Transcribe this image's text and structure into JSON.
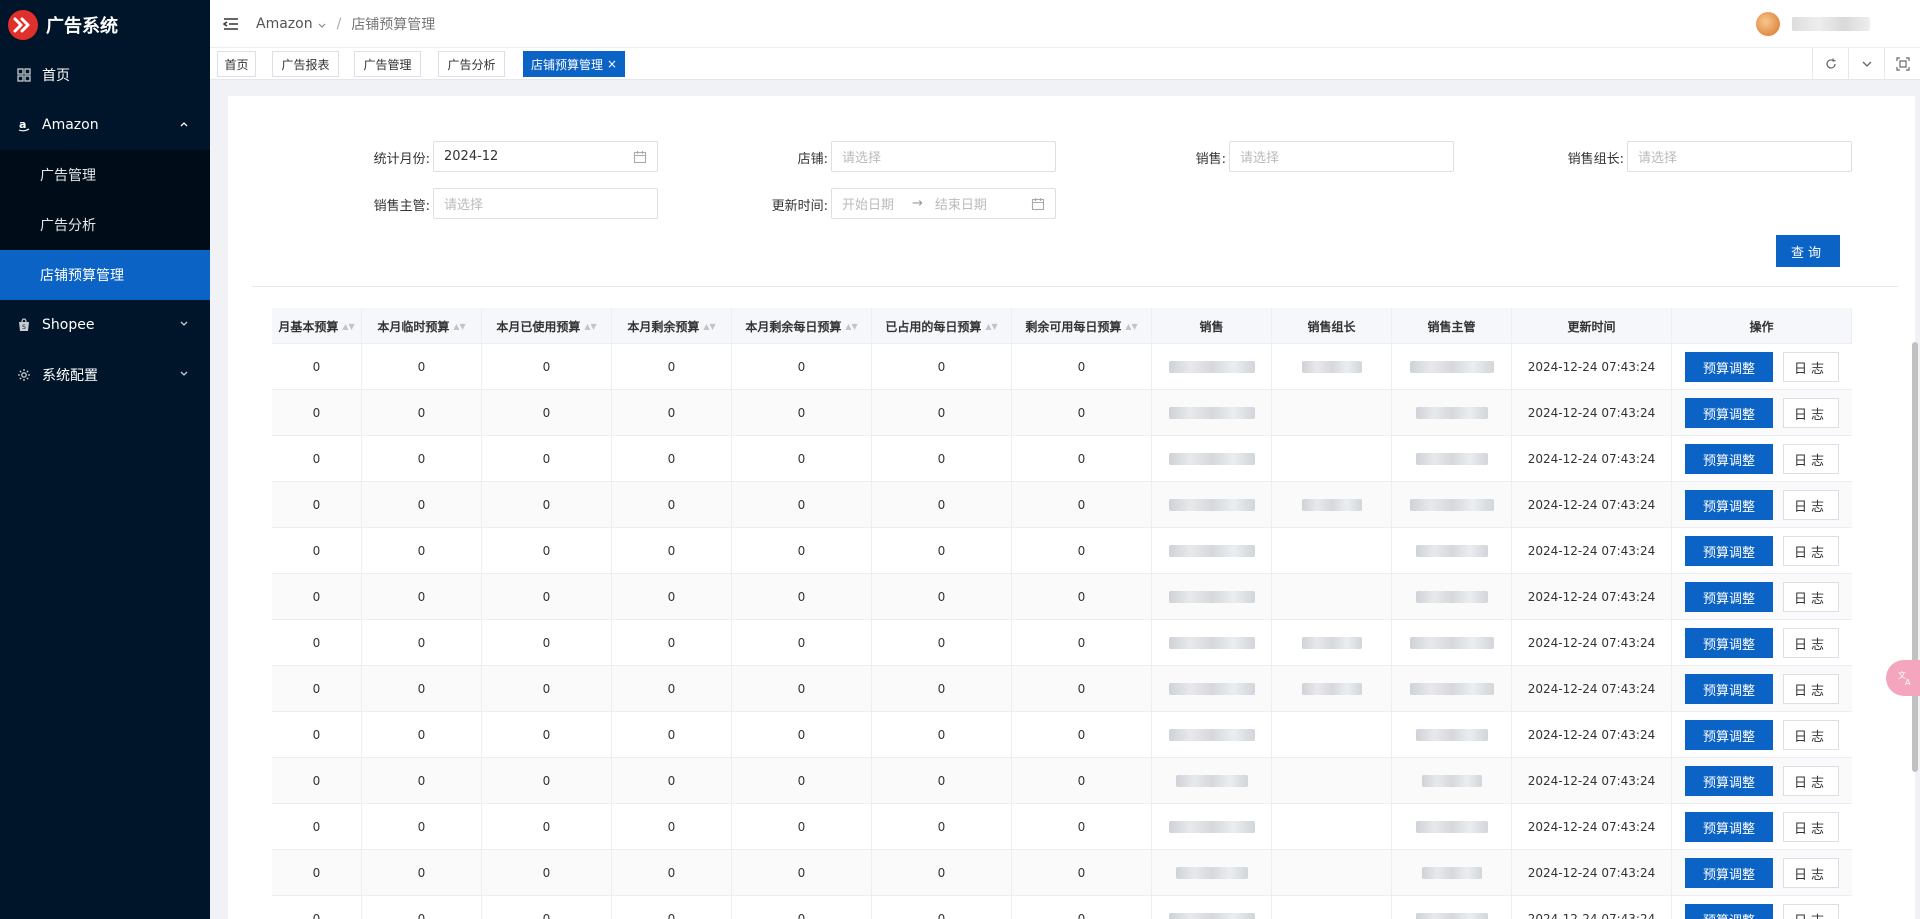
{
  "app": {
    "title": "广告系统"
  },
  "sidebar": {
    "items": [
      {
        "label": "首页",
        "icon": "grid-icon"
      },
      {
        "label": "Amazon",
        "icon": "amazon-icon",
        "expanded": true,
        "children": [
          {
            "label": "广告管理",
            "active": false
          },
          {
            "label": "广告分析",
            "active": false
          },
          {
            "label": "店铺预算管理",
            "active": true
          }
        ]
      },
      {
        "label": "Shopee",
        "icon": "shopee-bag-icon",
        "expanded": false
      },
      {
        "label": "系统配置",
        "icon": "gear-icon",
        "expanded": false
      }
    ]
  },
  "header": {
    "breadcrumb": {
      "root": "Amazon",
      "sep": "/",
      "current": "店铺预算管理"
    }
  },
  "tabs": [
    {
      "label": "首页"
    },
    {
      "label": "广告报表"
    },
    {
      "label": "广告管理"
    },
    {
      "label": "广告分析"
    },
    {
      "label": "店铺预算管理",
      "active": true,
      "close": "×"
    }
  ],
  "filters": {
    "month_label": "统计月份:",
    "month_value": "2024-12",
    "shop_label": "店铺:",
    "shop_placeholder": "请选择",
    "sales_label": "销售:",
    "sales_placeholder": "请选择",
    "leader_label": "销售组长:",
    "leader_placeholder": "请选择",
    "manager_label": "销售主管:",
    "manager_placeholder": "请选择",
    "update_label": "更新时间:",
    "start_placeholder": "开始日期",
    "range_sep": "→",
    "end_placeholder": "结束日期",
    "query_button": "查询"
  },
  "table": {
    "columns": [
      "月基本预算",
      "本月临时预算",
      "本月已使用预算",
      "本月剩余预算",
      "本月剩余每日预算",
      "已占用的每日预算",
      "剩余可用每日预算",
      "销售",
      "销售组长",
      "销售主管",
      "更新时间",
      "操作"
    ],
    "row_values": [
      "0",
      "0",
      "0",
      "0",
      "0",
      "0",
      "0"
    ],
    "update_time": "2024-12-24 07:43:24",
    "adjust_label": "预算调整",
    "log_label": "日志",
    "row_count": 13
  },
  "colors": {
    "primary": "#0b63c6",
    "sidebar_bg": "#001529",
    "logo": "#e0302b"
  }
}
